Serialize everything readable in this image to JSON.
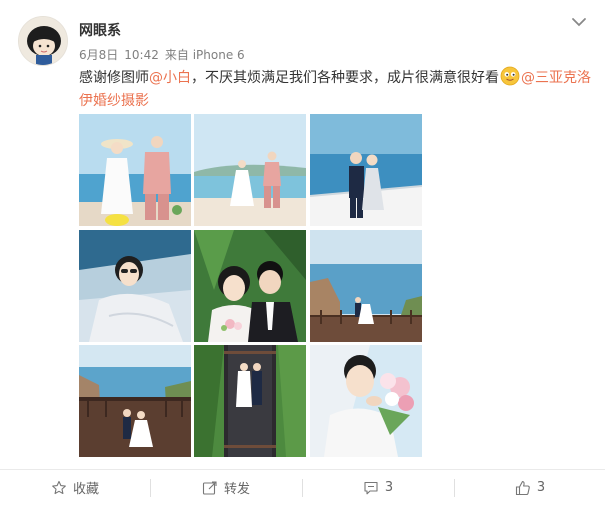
{
  "user": {
    "name": "网眼系",
    "date": "6月8日",
    "time": "10:42",
    "source": "来自 iPhone 6"
  },
  "post": {
    "text_1": "感谢修图师",
    "mention_1": "@小白",
    "text_2": "，不厌其烦满足我们各种要求，成片很满意很好看",
    "mention_2": "@三亚克洛伊婚纱摄影"
  },
  "photos": [
    {
      "icon": "beach-couple-photo"
    },
    {
      "icon": "beach-walk-photo"
    },
    {
      "icon": "yacht-couple-photo"
    },
    {
      "icon": "bride-portrait-photo"
    },
    {
      "icon": "couple-closeup-photo"
    },
    {
      "icon": "cliff-terrace-photo"
    },
    {
      "icon": "cliff-deck-couple-photo"
    },
    {
      "icon": "aerial-bridge-photo"
    },
    {
      "icon": "bride-bouquet-photo"
    }
  ],
  "actions": {
    "favorite": "收藏",
    "repost": "转发",
    "comment_count": "3",
    "like_count": "3"
  },
  "colors": {
    "mention": "#eb7350",
    "text": "#333333",
    "meta": "#808080"
  }
}
